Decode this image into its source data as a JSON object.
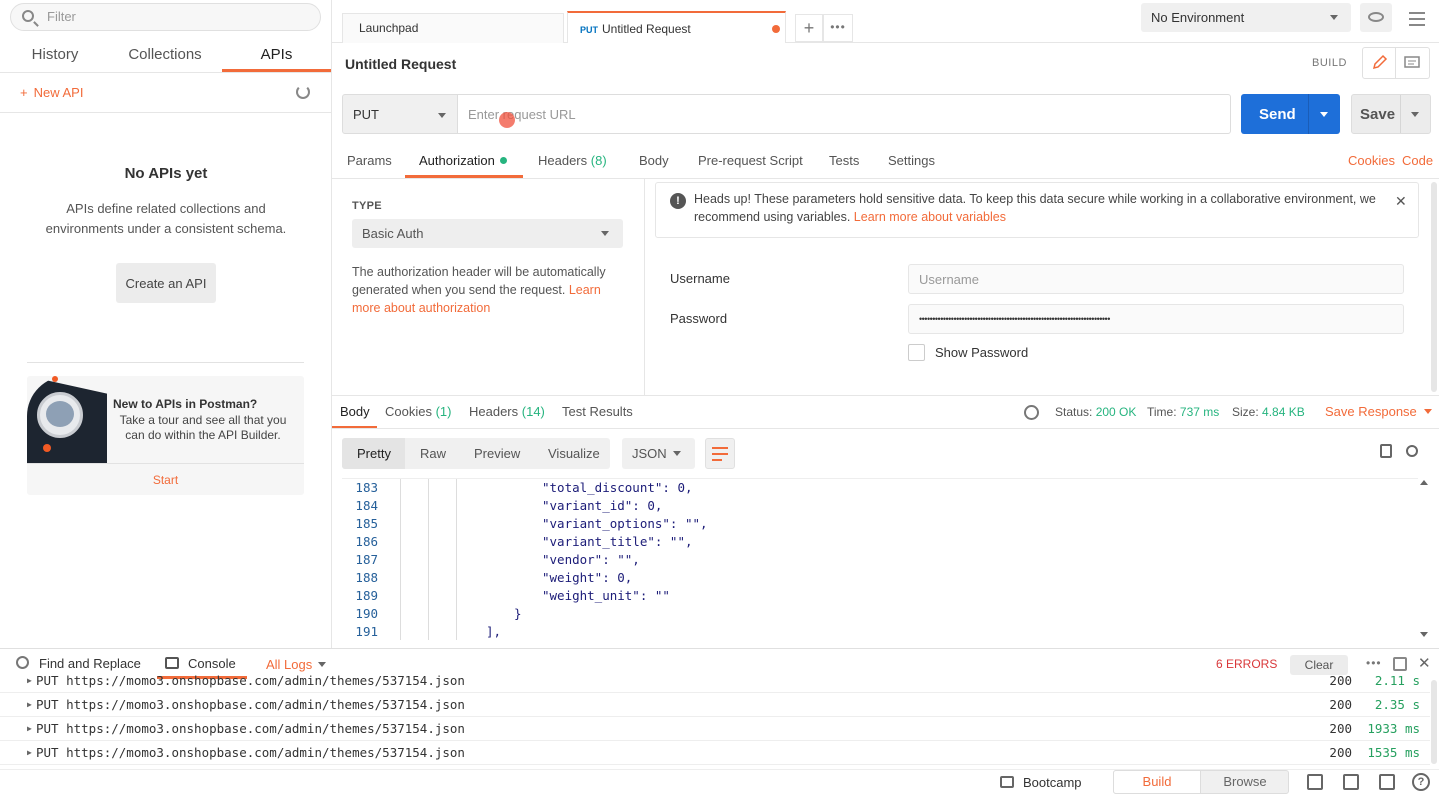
{
  "sidebar": {
    "filter_placeholder": "Filter",
    "tabs": [
      "History",
      "Collections",
      "APIs"
    ],
    "active_tab": "APIs",
    "new_api_label": "New API",
    "empty_title": "No APIs yet",
    "empty_desc": "APIs define related collections and environments under a consistent schema.",
    "create_button": "Create an API",
    "promo": {
      "title": "New to APIs in Postman?",
      "desc": "Take a tour and see all that you can do within the API Builder.",
      "start": "Start"
    }
  },
  "tabs": {
    "launchpad": "Launchpad",
    "untitled_method": "PUT",
    "untitled_label": "Untitled Request"
  },
  "environment": {
    "selected": "No Environment"
  },
  "request": {
    "title": "Untitled Request",
    "build_label": "BUILD",
    "method": "PUT",
    "url_placeholder": "Enter request URL",
    "send": "Send",
    "save": "Save",
    "tabs": {
      "params": "Params",
      "authorization": "Authorization",
      "headers": "Headers",
      "headers_count": "(8)",
      "body": "Body",
      "prerequest": "Pre-request Script",
      "tests": "Tests",
      "settings": "Settings",
      "cookies": "Cookies",
      "code": "Code"
    }
  },
  "auth": {
    "type_label": "TYPE",
    "type_value": "Basic Auth",
    "desc": "The authorization header will be automatically generated when you send the request. ",
    "desc_link": "Learn more about authorization",
    "alert_text": "Heads up! These parameters hold sensitive data. To keep this data secure while working in a collaborative environment, we recommend using variables. ",
    "alert_link": "Learn more about variables",
    "username_label": "Username",
    "username_placeholder": "Username",
    "password_label": "Password",
    "password_value": "••••••••••••••••••••••••••••••••••••••••••••••••••••••••••••••••••••••••",
    "show_password": "Show Password"
  },
  "response": {
    "tabs": {
      "body": "Body",
      "cookies": "Cookies",
      "cookies_count": "(1)",
      "headers": "Headers",
      "headers_count": "(14)",
      "test_results": "Test Results"
    },
    "status_label": "Status:",
    "status_value": "200 OK",
    "time_label": "Time:",
    "time_value": "737 ms",
    "size_label": "Size:",
    "size_value": "4.84 KB",
    "save_response": "Save Response",
    "formats": [
      "Pretty",
      "Raw",
      "Preview",
      "Visualize"
    ],
    "format_type": "JSON",
    "code_lines": [
      {
        "n": "183",
        "indent": 6,
        "text": "\"total_discount\": 0,"
      },
      {
        "n": "184",
        "indent": 6,
        "text": "\"variant_id\": 0,"
      },
      {
        "n": "185",
        "indent": 6,
        "text": "\"variant_options\": \"\","
      },
      {
        "n": "186",
        "indent": 6,
        "text": "\"variant_title\": \"\","
      },
      {
        "n": "187",
        "indent": 6,
        "text": "\"vendor\": \"\","
      },
      {
        "n": "188",
        "indent": 6,
        "text": "\"weight\": 0,"
      },
      {
        "n": "189",
        "indent": 6,
        "text": "\"weight_unit\": \"\""
      },
      {
        "n": "190",
        "indent": 5,
        "text": "}"
      },
      {
        "n": "191",
        "indent": 4,
        "text": "],"
      }
    ]
  },
  "console": {
    "find_replace": "Find and Replace",
    "console_label": "Console",
    "all_logs": "All Logs",
    "errors": "6 ERRORS",
    "clear": "Clear",
    "logs": [
      {
        "text": "PUT https://momo3.onshopbase.com/admin/themes/537154.json",
        "code": "200",
        "time": "2.11 s"
      },
      {
        "text": "PUT https://momo3.onshopbase.com/admin/themes/537154.json",
        "code": "200",
        "time": "2.35 s"
      },
      {
        "text": "PUT https://momo3.onshopbase.com/admin/themes/537154.json",
        "code": "200",
        "time": "1933 ms"
      },
      {
        "text": "PUT https://momo3.onshopbase.com/admin/themes/537154.json",
        "code": "200",
        "time": "1535 ms"
      }
    ]
  },
  "footer": {
    "bootcamp": "Bootcamp",
    "build": "Build",
    "browse": "Browse"
  },
  "colors": {
    "accent": "#f26b3a",
    "send": "#1e6fd9",
    "success": "#26b47f"
  }
}
